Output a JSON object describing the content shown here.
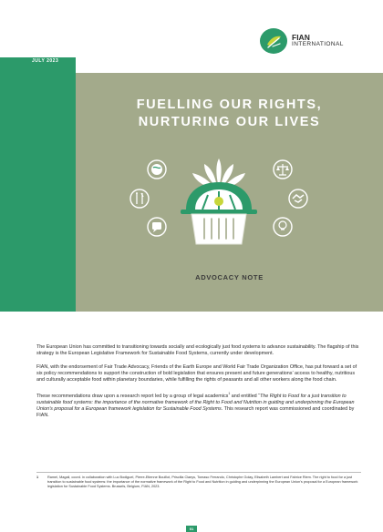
{
  "header": {
    "date": "JULY 2023",
    "logo_line1": "FIAN",
    "logo_line2": "INTERNATIONAL"
  },
  "title": {
    "line1": "FUELLING OUR RIGHTS,",
    "line2": "NURTURING OUR LIVES"
  },
  "subtitle": "ADVOCACY NOTE",
  "body": {
    "p1": "The European Union has committed to transitioning towards socially and ecologically just food systems to advance sustainability. The flagship of this strategy is the European Legislative Framework for Sustainable Food Systems, currently under development.",
    "p2": "FIAN, with the endorsement of Fair Trade Advocacy, Friends of the Earth Europe and World Fair Trade Organization Office, has put forward a set of six policy recommendations to support the construction of bold legislation that ensures present and future generations’ access to healthy, nutritious and culturally acceptable food within planetary boundaries, while fulfilling the rights of peasants and all other workers along the food chain.",
    "p3_start": "These recommendations draw upon a research report led by a group of legal academics",
    "p3_sup": "1",
    "p3_mid": " and entitled “",
    "p3_italic": "The Right to Food for a just transition to sustainable food systems: the importance of the normative framework of the Right to Food and Nutrition in guiding and underpinning the European Union’s proposal for a European framework legislation for Sustainable Food Systems.",
    "p3_end": " This research report was commissioned and coordinated by FIAN."
  },
  "footnote": {
    "num": "1",
    "text": "Ramel, Magali, coord. in collaboration with Luc Bodiguel, Pierre-Etienne Bouillot, Priscilla Claeys, Tomaso Ferrando, Christophe Golay, Elisabeth Lambert and Fabrice Riem. The right to food for a just transition to sustainable food systems: the importance of the normative framework of the Right to Food and Nutrition in guiding and underpinning the European Union’s proposal for a European framework legislation for Sustainable Food Systems. Brussels, Belgium, FIAN, 2023."
  },
  "page_number": "01",
  "colors": {
    "brand_green": "#2c9a6a",
    "hero_olive": "#a3aa8b"
  }
}
